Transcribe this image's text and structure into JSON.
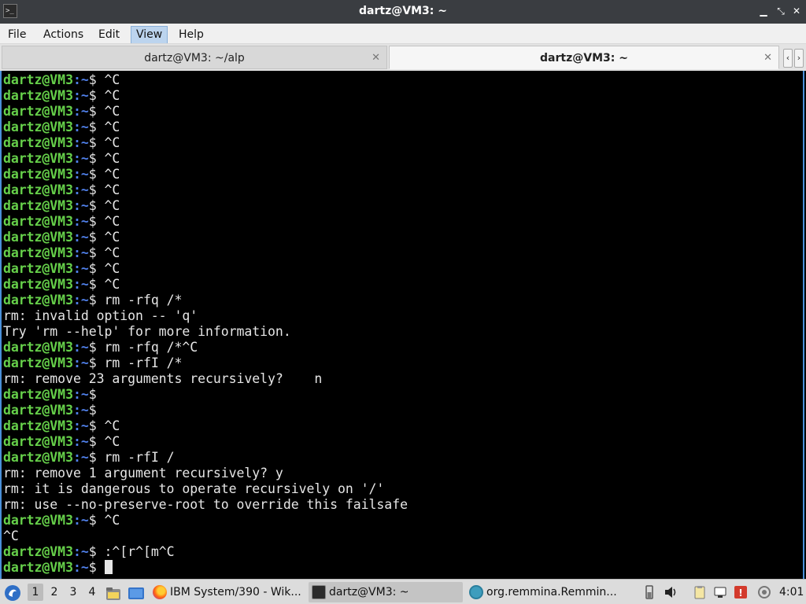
{
  "window": {
    "title": "dartz@VM3: ~",
    "minimize": "▁",
    "maximize": "⤡",
    "close": "✕"
  },
  "menu": [
    "File",
    "Actions",
    "Edit",
    "View",
    "Help"
  ],
  "tabs": [
    {
      "label": "dartz@VM3: ~/alp",
      "close": "✕"
    },
    {
      "label": "dartz@VM3: ~",
      "close": "✕"
    }
  ],
  "tab_nav": {
    "prev": "‹",
    "next": "›"
  },
  "prompt": {
    "user": "dartz@VM3",
    "colon": ":",
    "path": "~",
    "dollar": "$ "
  },
  "terminal_lines": [
    {
      "prompt": true,
      "text": "^C"
    },
    {
      "prompt": true,
      "text": "^C"
    },
    {
      "prompt": true,
      "text": "^C"
    },
    {
      "prompt": true,
      "text": "^C"
    },
    {
      "prompt": true,
      "text": "^C"
    },
    {
      "prompt": true,
      "text": "^C"
    },
    {
      "prompt": true,
      "text": "^C"
    },
    {
      "prompt": true,
      "text": "^C"
    },
    {
      "prompt": true,
      "text": "^C"
    },
    {
      "prompt": true,
      "text": "^C"
    },
    {
      "prompt": true,
      "text": "^C"
    },
    {
      "prompt": true,
      "text": "^C"
    },
    {
      "prompt": true,
      "text": "^C"
    },
    {
      "prompt": true,
      "text": "^C"
    },
    {
      "prompt": true,
      "text": "rm -rfq /*"
    },
    {
      "prompt": false,
      "text": "rm: invalid option -- 'q'"
    },
    {
      "prompt": false,
      "text": "Try 'rm --help' for more information."
    },
    {
      "prompt": true,
      "text": "rm -rfq /*^C"
    },
    {
      "prompt": true,
      "text": "rm -rfI /*"
    },
    {
      "prompt": false,
      "text": "rm: remove 23 arguments recursively?    n"
    },
    {
      "prompt": true,
      "text": ""
    },
    {
      "prompt": true,
      "text": ""
    },
    {
      "prompt": true,
      "text": "^C"
    },
    {
      "prompt": true,
      "text": "^C"
    },
    {
      "prompt": true,
      "text": "rm -rfI /"
    },
    {
      "prompt": false,
      "text": "rm: remove 1 argument recursively? y"
    },
    {
      "prompt": false,
      "text": "rm: it is dangerous to operate recursively on '/'"
    },
    {
      "prompt": false,
      "text": "rm: use --no-preserve-root to override this failsafe"
    },
    {
      "prompt": true,
      "text": "^C"
    },
    {
      "prompt": false,
      "text": "^C"
    },
    {
      "prompt": true,
      "text": ":^[r^[m^C"
    },
    {
      "prompt": true,
      "text": "",
      "cursor": true
    }
  ],
  "taskbar": {
    "desktops": [
      "1",
      "2",
      "3",
      "4"
    ],
    "current_desktop": "1",
    "tasks": [
      {
        "label": "IBM System/390 - Wik...",
        "icon": "firefox-icon",
        "active": false
      },
      {
        "label": "dartz@VM3: ~",
        "icon": "terminal-icon",
        "active": true
      },
      {
        "label": "org.remmina.Remmin...",
        "icon": "remmina-icon",
        "active": false
      }
    ],
    "clock": "4:01"
  },
  "colors": {
    "prompt_user": "#66d04a",
    "prompt_path": "#4f7fe8",
    "terminal_bg": "#000000",
    "terminal_fg": "#e6e6e6",
    "titlebar_bg": "#3a3d41"
  }
}
